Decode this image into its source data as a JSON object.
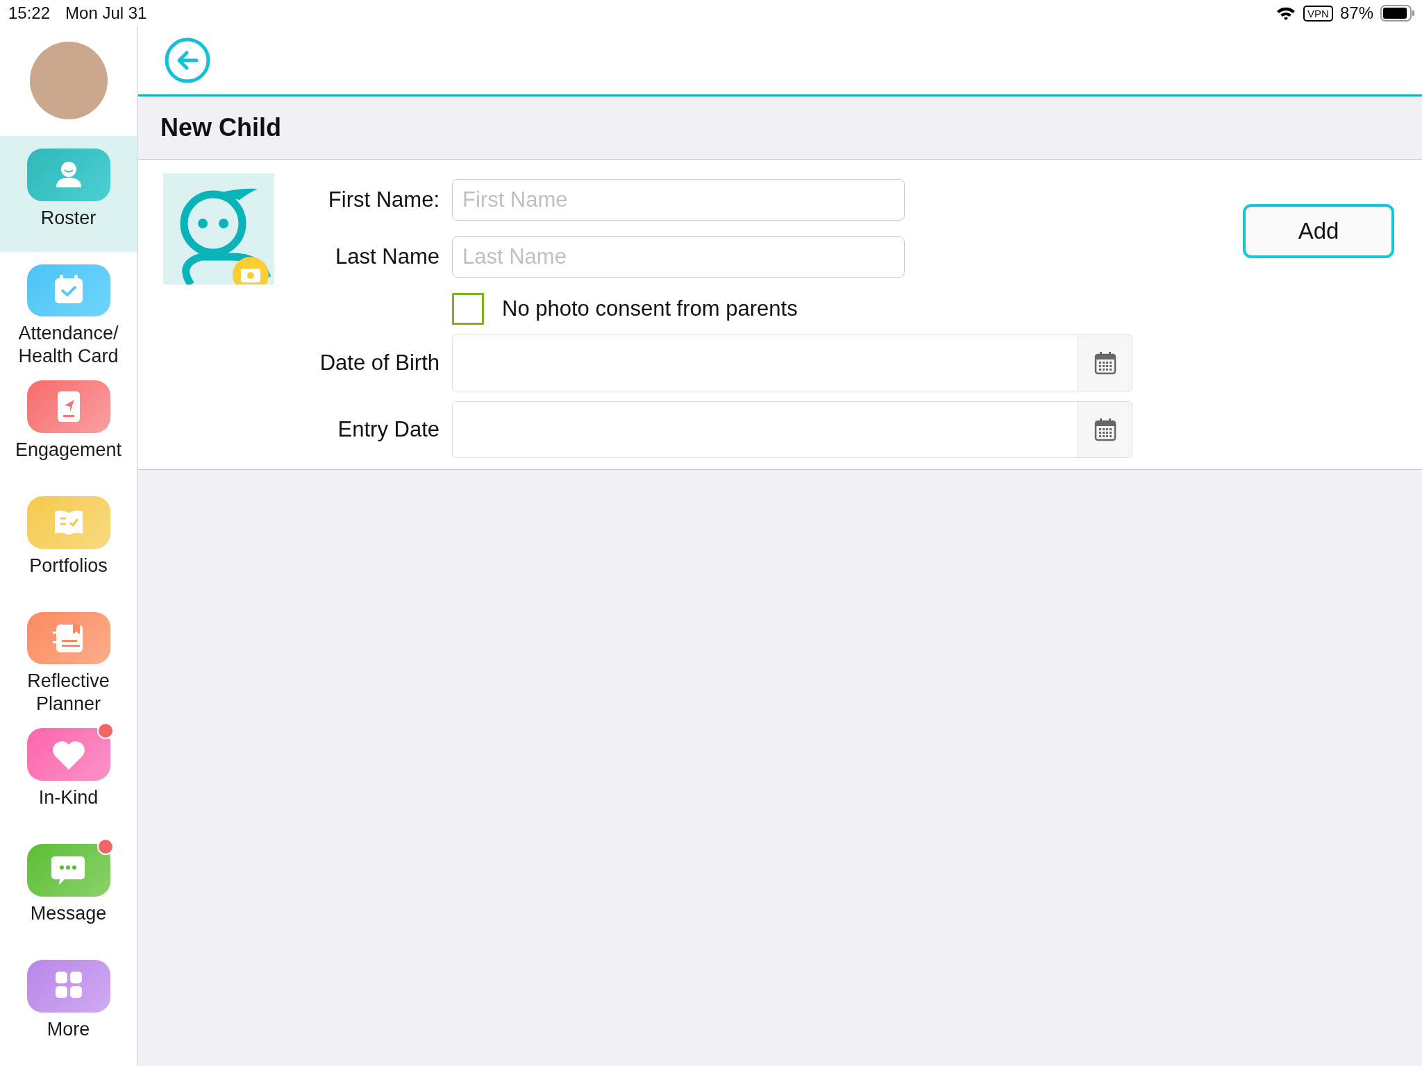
{
  "status_bar": {
    "time": "15:22",
    "date": "Mon Jul 31",
    "vpn": "VPN",
    "battery": "87%"
  },
  "sidebar": {
    "items": [
      {
        "kind": "roster",
        "label": "Roster",
        "selected": true,
        "badge": false
      },
      {
        "kind": "attendance",
        "label": "Attendance/ Health Card",
        "selected": false,
        "badge": false
      },
      {
        "kind": "engagement",
        "label": "Engagement",
        "selected": false,
        "badge": false
      },
      {
        "kind": "portfolios",
        "label": "Portfolios",
        "selected": false,
        "badge": false
      },
      {
        "kind": "planner",
        "label": "Reflective Planner",
        "selected": false,
        "badge": false
      },
      {
        "kind": "inkind",
        "label": "In-Kind",
        "selected": false,
        "badge": true
      },
      {
        "kind": "message",
        "label": "Message",
        "selected": false,
        "badge": true
      },
      {
        "kind": "more",
        "label": "More",
        "selected": false,
        "badge": false
      }
    ]
  },
  "header": {
    "title": "New Child"
  },
  "form": {
    "fields": [
      {
        "kind": "text",
        "label": "First Name:",
        "placeholder": "First Name"
      },
      {
        "kind": "text",
        "label": "Last Name",
        "placeholder": "Last Name"
      },
      {
        "kind": "checkbox",
        "label": "No photo consent from parents",
        "checked": false
      },
      {
        "kind": "date",
        "label": "Date of Birth"
      },
      {
        "kind": "date",
        "label": "Entry Date"
      }
    ],
    "add_button": "Add"
  }
}
